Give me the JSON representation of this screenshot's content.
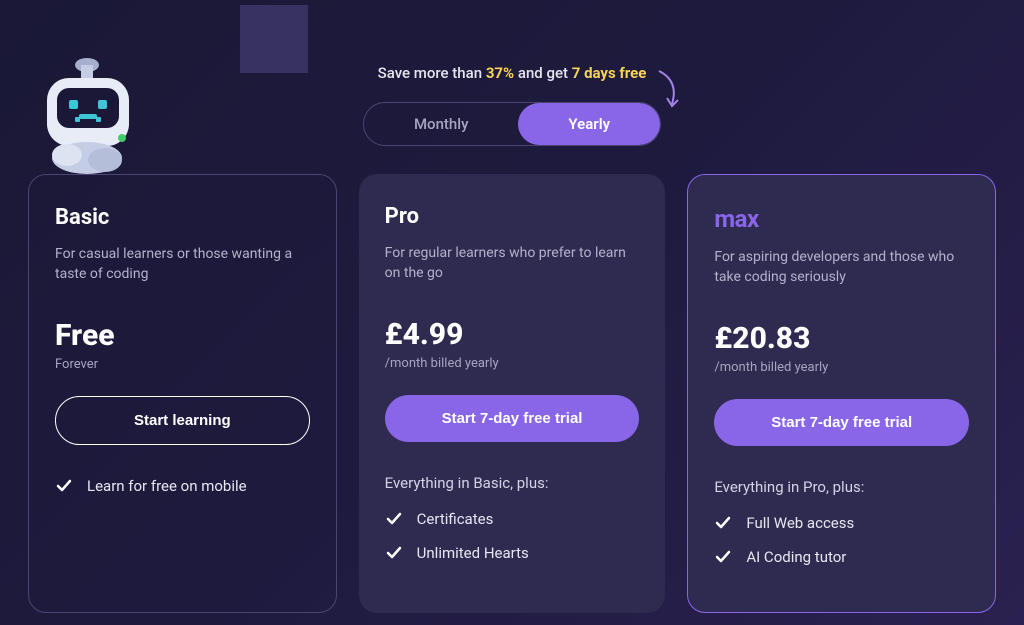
{
  "promo": {
    "prefix": "Save more than ",
    "percent": "37%",
    "middle": " and get ",
    "trial": "7 days free"
  },
  "toggle": {
    "monthly": "Monthly",
    "yearly": "Yearly"
  },
  "plans": {
    "basic": {
      "title": "Basic",
      "sub": "For casual learners or those wanting a taste of coding",
      "price": "Free",
      "price_note": "Forever",
      "cta": "Start learning",
      "features": [
        "Learn for free on mobile"
      ]
    },
    "pro": {
      "title": "Pro",
      "sub": "For regular learners who prefer to learn on the go",
      "price": "£4.99",
      "price_note": "/month billed yearly",
      "cta": "Start 7-day free trial",
      "features_head": "Everything in Basic, plus:",
      "features": [
        "Certificates",
        "Unlimited Hearts"
      ]
    },
    "max": {
      "title": "max",
      "sub": "For aspiring developers and those who take coding seriously",
      "price": "£20.83",
      "price_note": "/month billed yearly",
      "cta": "Start 7-day free trial",
      "features_head": "Everything in Pro, plus:",
      "features": [
        "Full Web access",
        "AI Coding tutor"
      ]
    }
  }
}
